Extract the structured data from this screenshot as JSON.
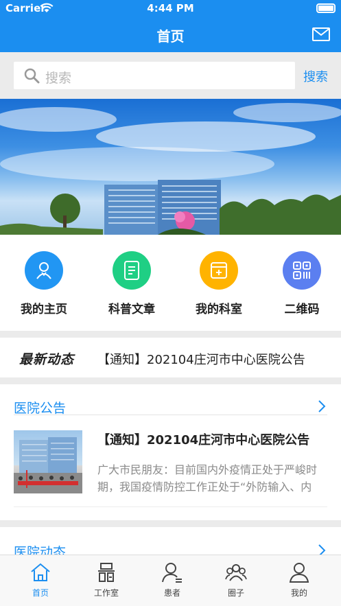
{
  "status": {
    "carrier": "Carrier",
    "time": "4:44 PM"
  },
  "nav": {
    "title": "首页"
  },
  "search": {
    "placeholder": "搜索",
    "button": "搜索"
  },
  "shortcuts": [
    {
      "label": "我的主页",
      "color": "#2196f3"
    },
    {
      "label": "科普文章",
      "color": "#1fcf84"
    },
    {
      "label": "我的科室",
      "color": "#ffb300"
    },
    {
      "label": "二维码",
      "color": "#5b7ff0"
    }
  ],
  "ticker": {
    "tag": "最新动态",
    "text": "【通知】202104庄河市中心医院公告"
  },
  "announcements": {
    "title": "医院公告",
    "article": {
      "title": "【通知】202104庄河市中心医院公告",
      "summary": "广大市民朋友：目前国内外疫情正处于严峻时期，我国疫情防控工作正处于“外防输入、内防反弹”的关键阶段"
    }
  },
  "dynamics": {
    "title": "医院动态"
  },
  "tabs": [
    {
      "label": "首页",
      "icon": "home-icon"
    },
    {
      "label": "工作室",
      "icon": "workroom-icon"
    },
    {
      "label": "患者",
      "icon": "patient-icon"
    },
    {
      "label": "圈子",
      "icon": "circle-group-icon"
    },
    {
      "label": "我的",
      "icon": "profile-icon"
    }
  ],
  "colors": {
    "primary": "#1b8ef0",
    "background": "#ebebeb"
  }
}
